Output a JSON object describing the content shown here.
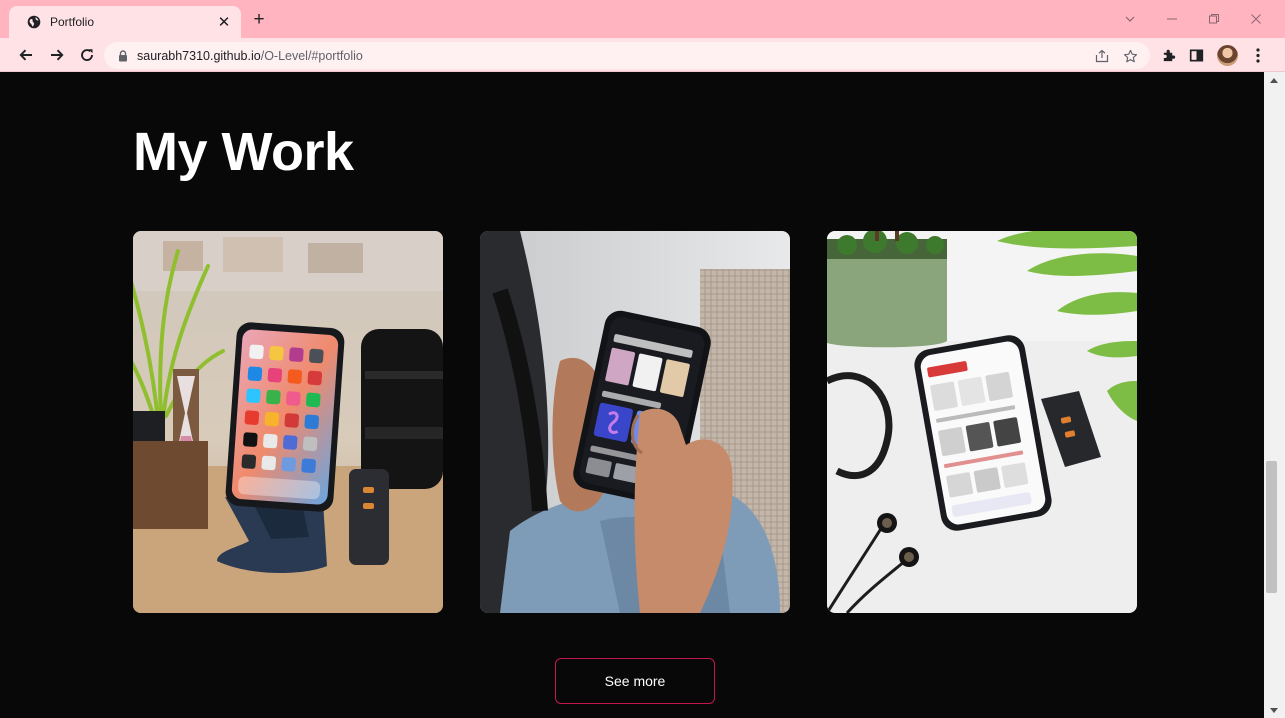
{
  "browser": {
    "tab_title": "Portfolio",
    "url_host": "saurabh7310.github.io",
    "url_path": "/O-Level/#portfolio"
  },
  "page": {
    "heading": "My Work",
    "see_more_label": "See more"
  },
  "colors": {
    "tabstrip": "#ffb4c0",
    "toolbar": "#ffe2e6",
    "page_background": "#080808",
    "button_border": "#c2184b"
  },
  "icons": [
    "globe-icon",
    "close-icon",
    "plus-icon",
    "back-arrow-icon",
    "forward-arrow-icon",
    "reload-icon",
    "lock-icon",
    "share-icon",
    "star-icon",
    "extensions-icon",
    "side-panel-icon",
    "profile-avatar",
    "menu-icon"
  ]
}
